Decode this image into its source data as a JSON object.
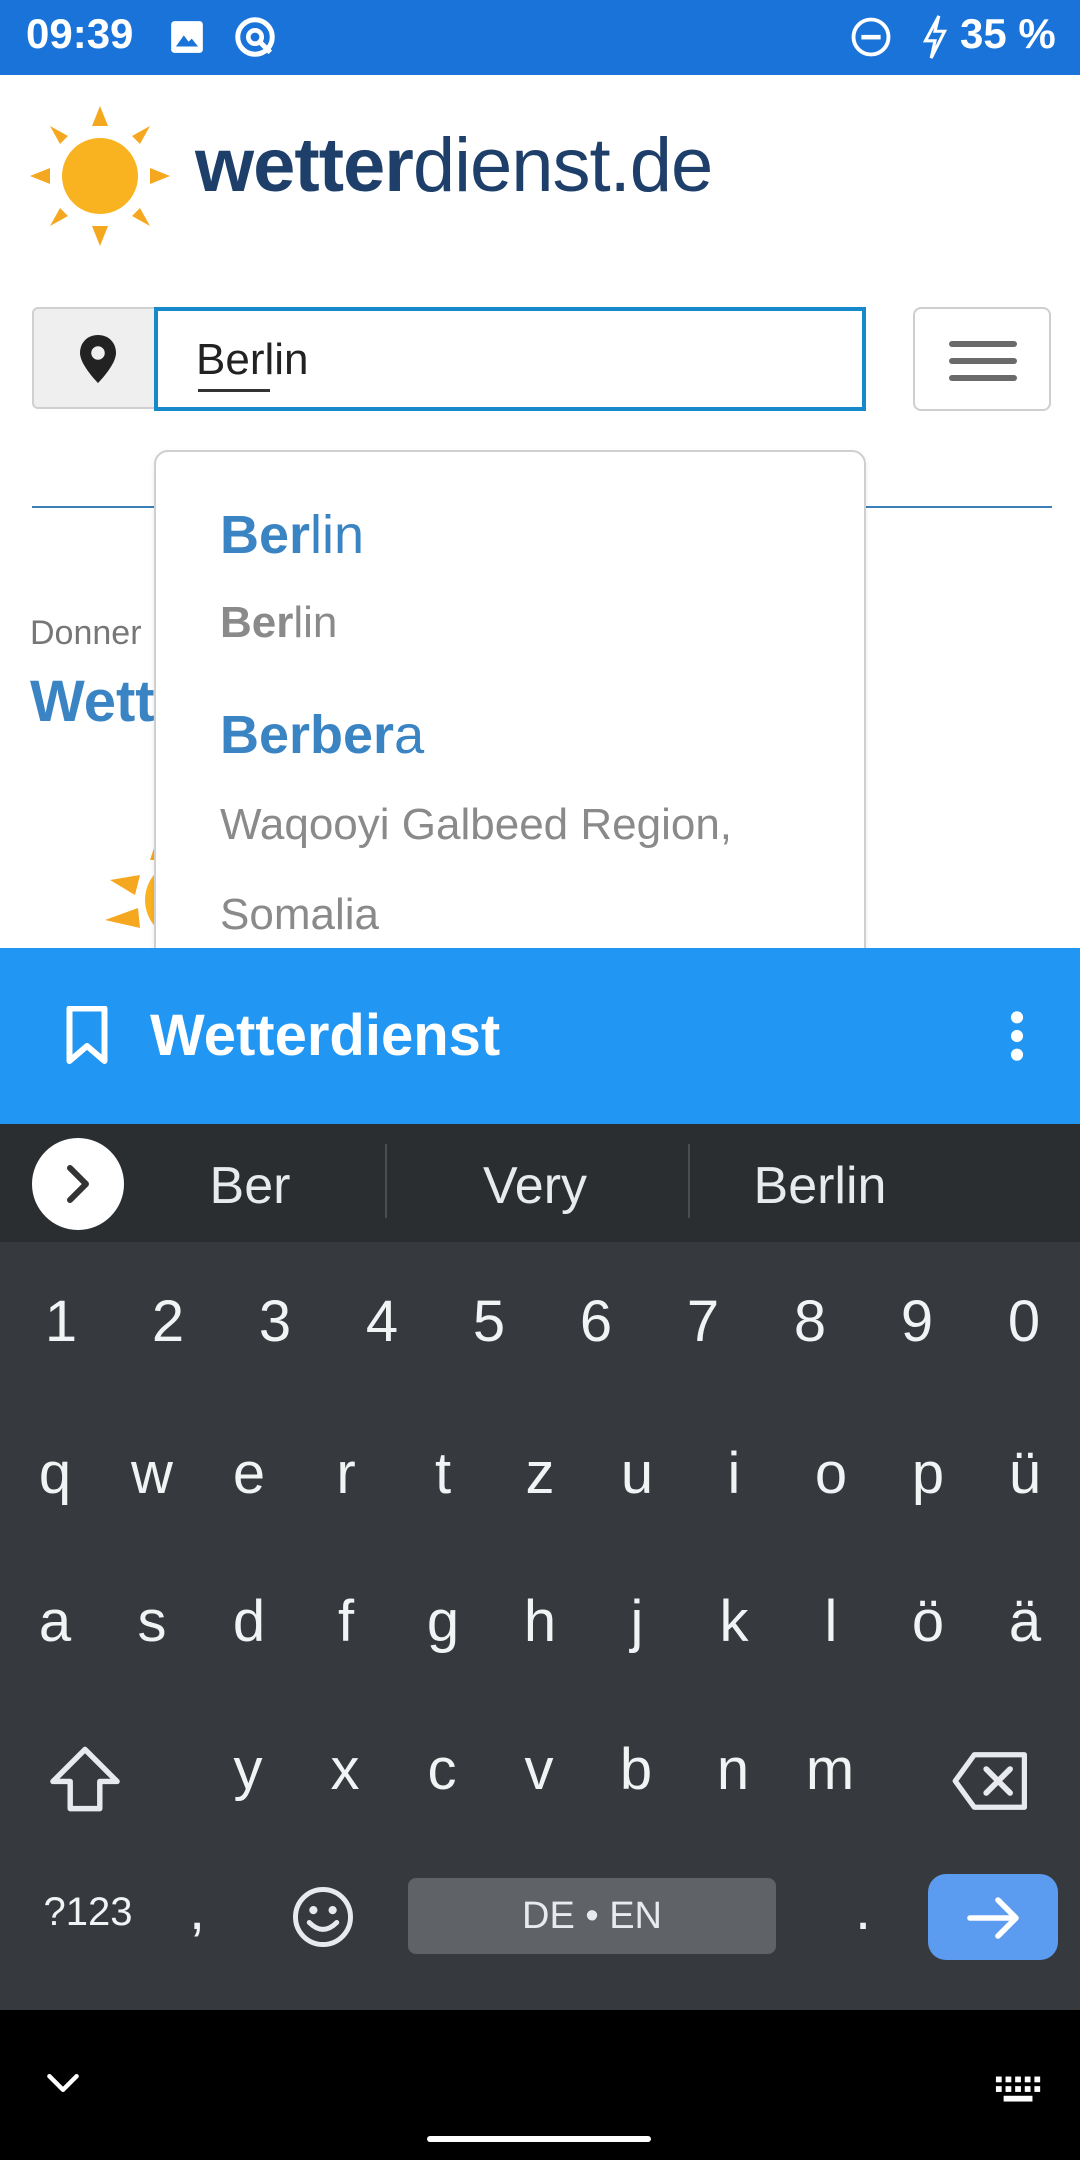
{
  "status_bar": {
    "time": "09:39",
    "battery": "35 %",
    "icons": [
      "image-icon",
      "q-icon",
      "do-not-disturb-icon",
      "charging-bolt-icon"
    ]
  },
  "header": {
    "logo_bold": "wetter",
    "logo_rest": "dienst.de",
    "logo_icon": "sun-icon"
  },
  "search": {
    "value_bold": "Ber",
    "value_rest": "lin",
    "location_icon": "location-pin-icon",
    "menu_icon": "hamburger-menu-icon"
  },
  "background": {
    "label": "Donner",
    "title": "Wett"
  },
  "autocomplete": {
    "items": [
      {
        "name_bold": "Ber",
        "name_rest": "lin",
        "sub_bold": "Ber",
        "sub_rest": "lin"
      },
      {
        "name_bold": "Berber",
        "name_rest": "a",
        "sub_line1": "Waqooyi Galbeed Region,",
        "sub_line2": "Somalia"
      }
    ]
  },
  "toolbar": {
    "title": "Wetterdienst",
    "bookmark_icon": "bookmark-icon",
    "more_icon": "more-vert-icon",
    "color": "#2196f3"
  },
  "keyboard": {
    "suggestions": [
      "Ber",
      "Very",
      "Berlin"
    ],
    "numbers": [
      "1",
      "2",
      "3",
      "4",
      "5",
      "6",
      "7",
      "8",
      "9",
      "0"
    ],
    "row1": [
      "q",
      "w",
      "e",
      "r",
      "t",
      "z",
      "u",
      "i",
      "o",
      "p",
      "ü"
    ],
    "row2": [
      "a",
      "s",
      "d",
      "f",
      "g",
      "h",
      "j",
      "k",
      "l",
      "ö",
      "ä"
    ],
    "row3": [
      "y",
      "x",
      "c",
      "v",
      "b",
      "n",
      "m"
    ],
    "symbols_key": "?123",
    "comma_key": ",",
    "period_key": ".",
    "space_label": "DE • EN",
    "enter_color": "#5c9cf0"
  }
}
